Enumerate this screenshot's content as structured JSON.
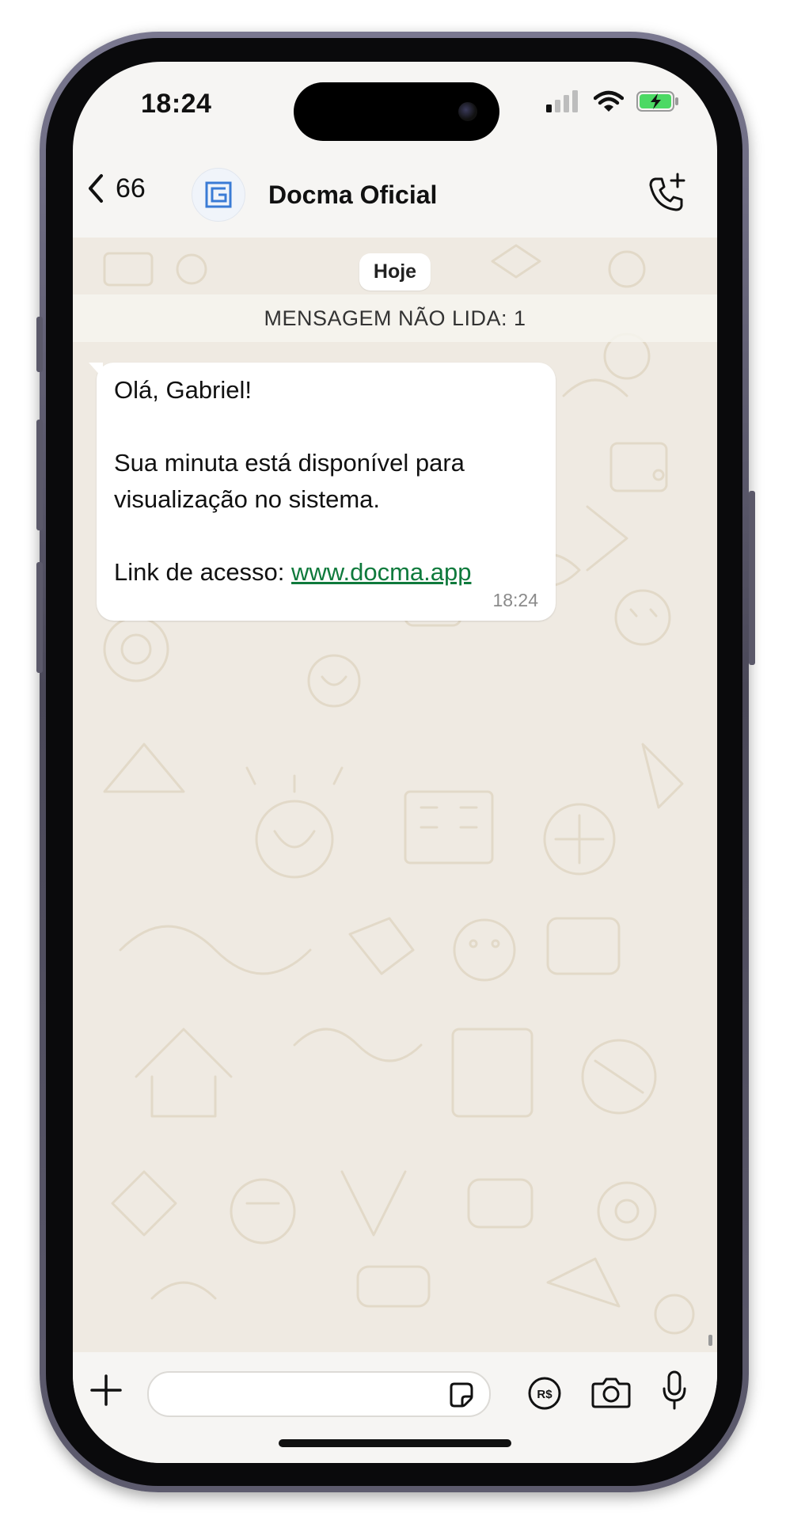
{
  "status_bar": {
    "time": "18:24"
  },
  "header": {
    "back_count": "66",
    "contact_name": "Docma Oficial"
  },
  "chat": {
    "day_label": "Hoje",
    "unread_banner": "MENSAGEM NÃO LIDA: 1",
    "message": {
      "greeting": "Olá, Gabriel!",
      "body": "Sua minuta está disponível para visualização no sistema.",
      "link_prefix": "Link de acesso: ",
      "link_text": "www.docma.app",
      "time": "18:24"
    }
  },
  "input_bar": {
    "placeholder": ""
  },
  "colors": {
    "wallpaper": "#efeae2",
    "doodle_stroke": "#e2d9c8",
    "link": "#0f7a3c",
    "battery_fill": "#4cd964",
    "avatar_logo": "#3a7bd5"
  },
  "icons": {
    "back": "chevron-left-icon",
    "avatar_logo": "docma-logo-icon",
    "call": "phone-add-icon",
    "plus": "plus-icon",
    "sticker": "sticker-icon",
    "payment": "brl-payment-icon",
    "camera": "camera-icon",
    "mic": "microphone-icon"
  }
}
